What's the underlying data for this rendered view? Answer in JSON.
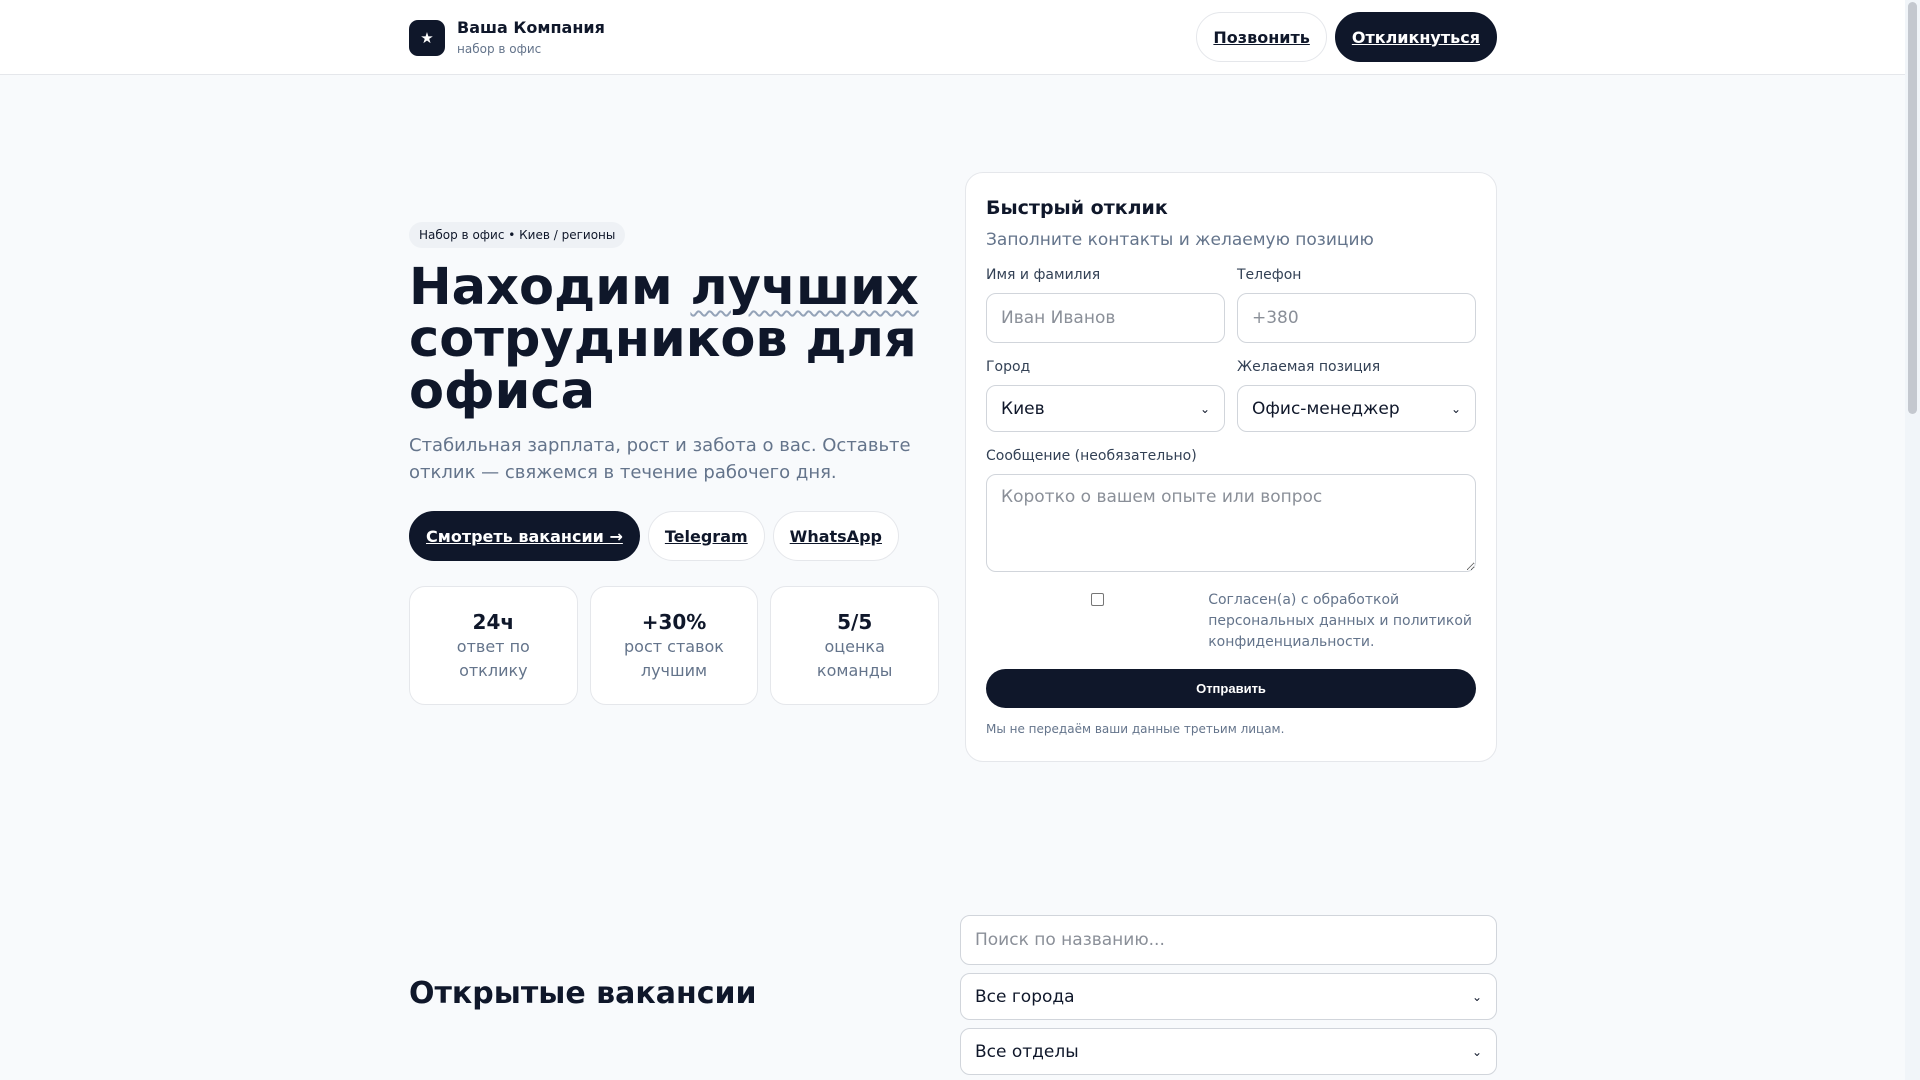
{
  "header": {
    "logo_glyph": "★",
    "company_name": "Ваша Компания",
    "company_sub": "набор в офис",
    "call_label": "Позвонить",
    "apply_label": "Откликнуться"
  },
  "hero": {
    "badge": "Набор в офис • Киев / регионы",
    "title_before": "Находим ",
    "title_accent": "лучших",
    "title_after": " сотрудников для офиса",
    "description": "Стабильная зарплата, рост и забота о вас. Оставьте отклик — свяжемся в течение рабочего дня.",
    "view_vacancies_label": "Смотреть вакансии →",
    "telegram_label": "Telegram",
    "whatsapp_label": "WhatsApp",
    "stats": [
      {
        "value": "24ч",
        "label": "ответ по отклику"
      },
      {
        "value": "+30%",
        "label": "рост ставок лучшим"
      },
      {
        "value": "5/5",
        "label": "оценка команды"
      }
    ]
  },
  "form": {
    "title": "Быстрый отклик",
    "subtitle": "Заполните контакты и желаемую позицию",
    "name_label": "Имя и фамилия",
    "name_placeholder": "Иван Иванов",
    "name_value": "",
    "phone_label": "Телефон",
    "phone_placeholder": "+380",
    "phone_value": "",
    "city_label": "Город",
    "city_value": "Киев",
    "position_label": "Желаемая позиция",
    "position_value": "Офис-менеджер",
    "message_label": "Сообщение (необязательно)",
    "message_placeholder": "Коротко о вашем опыте или вопрос",
    "consent_checked": false,
    "consent_text": "Согласен(а) с обработкой персональных данных и политикой конфиденциальности.",
    "submit_label": "Отправить",
    "privacy_note": "Мы не передаём ваши данные третьим лицам."
  },
  "vacancies": {
    "title": "Открытые вакансии",
    "search_placeholder": "Поиск по названию...",
    "city_filter_value": "Все города",
    "department_filter_value": "Все отделы"
  },
  "icons": {
    "logo": "star-icon",
    "select_arrow": "chevron-down-icon"
  },
  "colors": {
    "primary": "#0f172a",
    "muted_text": "#64748b",
    "border": "#e5e7eb",
    "background": "#f8fafc"
  }
}
